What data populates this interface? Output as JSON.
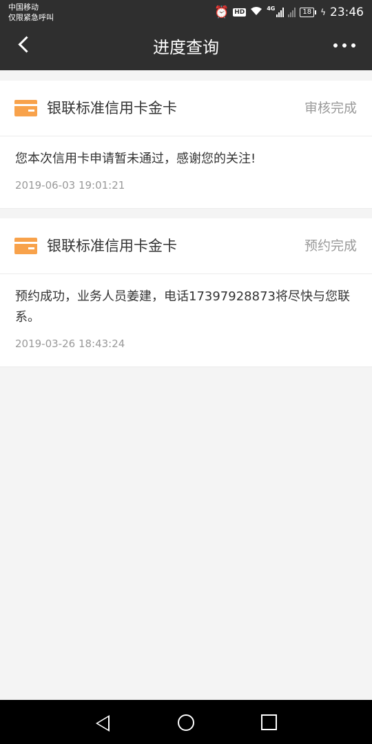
{
  "status_bar": {
    "carrier_line1": "中国移动",
    "carrier_line2": "仅限紧急呼叫",
    "net_type": "4G",
    "hd_label": "HD",
    "battery": "18",
    "time": "23:46"
  },
  "app_bar": {
    "title": "进度查询"
  },
  "records": [
    {
      "card_name": "银联标准信用卡金卡",
      "status": "审核完成",
      "message": "您本次信用卡申请暂未通过，感谢您的关注!",
      "time": "2019-06-03 19:01:21"
    },
    {
      "card_name": "银联标准信用卡金卡",
      "status": "预约完成",
      "message": "预约成功，业务人员姜建，电话17397928873将尽快与您联系。",
      "time": "2019-03-26 18:43:24"
    }
  ],
  "colors": {
    "header_bg": "#2f2f2f",
    "card_icon": "#f8a24b",
    "page_bg": "#f4f4f4"
  }
}
